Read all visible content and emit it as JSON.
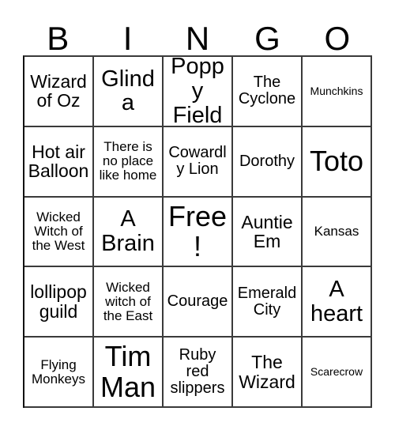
{
  "header": {
    "letters": [
      "B",
      "I",
      "N",
      "G",
      "O"
    ]
  },
  "grid": {
    "rows": [
      [
        {
          "text": "Wizard of Oz",
          "size": "fs-l"
        },
        {
          "text": "Glinda",
          "size": "fs-xl"
        },
        {
          "text": "Poppy Field",
          "size": "fs-xl"
        },
        {
          "text": "The Cyclone",
          "size": "fs-m"
        },
        {
          "text": "Munchkins",
          "size": "fs-xs"
        }
      ],
      [
        {
          "text": "Hot air Balloon",
          "size": "fs-l"
        },
        {
          "text": "There is no place like home",
          "size": "fs-s"
        },
        {
          "text": "Cowardly Lion",
          "size": "fs-m"
        },
        {
          "text": "Dorothy",
          "size": "fs-m"
        },
        {
          "text": "Toto",
          "size": "fs-xxl"
        }
      ],
      [
        {
          "text": "Wicked Witch of the West",
          "size": "fs-s"
        },
        {
          "text": "A Brain",
          "size": "fs-xl"
        },
        {
          "text": "Free!",
          "size": "fs-xxl"
        },
        {
          "text": "Auntie Em",
          "size": "fs-l"
        },
        {
          "text": "Kansas",
          "size": "fs-s"
        }
      ],
      [
        {
          "text": "lollipop guild",
          "size": "fs-l"
        },
        {
          "text": "Wicked witch of the East",
          "size": "fs-s"
        },
        {
          "text": "Courage",
          "size": "fs-m"
        },
        {
          "text": "Emerald City",
          "size": "fs-m"
        },
        {
          "text": "A heart",
          "size": "fs-xl"
        }
      ],
      [
        {
          "text": "Flying Monkeys",
          "size": "fs-s"
        },
        {
          "text": "Tim Man",
          "size": "fs-xxl"
        },
        {
          "text": "Ruby red slippers",
          "size": "fs-m"
        },
        {
          "text": "The Wizard",
          "size": "fs-l"
        },
        {
          "text": "Scarecrow",
          "size": "fs-xs"
        }
      ]
    ]
  },
  "colors": {
    "border": "#3a3a3a",
    "text": "#000000",
    "background": "#ffffff"
  }
}
